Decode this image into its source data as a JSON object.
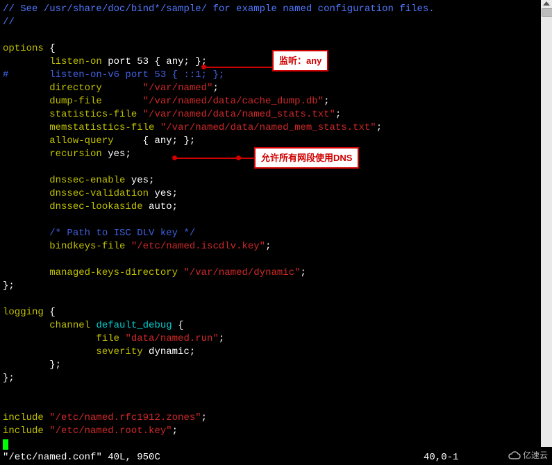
{
  "editor": {
    "filename": "/etc/named.conf",
    "lines_cols": "40L, 950C",
    "cursor_pos": "40,0-1",
    "comment1": "// See /usr/share/doc/bind*/sample/ for example named configuration files.",
    "comment2": "//",
    "options_kw": "options",
    "lbrace": "{",
    "rbrace_semi": "};",
    "listen_on": "listen-on",
    "port_kw": "port",
    "port_val": "53",
    "any_block": "{ any; };",
    "listen_on_v6_line": "#       listen-on-v6 port 53 { ::1; };",
    "directory_kw": "directory",
    "directory_val": "\"/var/named\"",
    "dump_file_kw": "dump-file",
    "dump_file_val": "\"/var/named/data/cache_dump.db\"",
    "stats_file_kw": "statistics-file",
    "stats_file_val": "\"/var/named/data/named_stats.txt\"",
    "memstats_kw": "memstatistics-file",
    "memstats_val": "\"/var/named/data/named_mem_stats.txt\"",
    "allow_query_kw": "allow-query",
    "recursion_kw": "recursion",
    "yes_kw": "yes",
    "no_semi": ";",
    "dnssec_enable_kw": "dnssec-enable",
    "dnssec_validation_kw": "dnssec-validation",
    "dnssec_lookaside_kw": "dnssec-lookaside",
    "auto_kw": "auto",
    "path_comment": "/* Path to ISC DLV key */",
    "bindkeys_kw": "bindkeys-file",
    "bindkeys_val": "\"/etc/named.iscdlv.key\"",
    "managed_keys_kw": "managed-keys-directory",
    "managed_keys_val": "\"/var/named/dynamic\"",
    "logging_kw": "logging",
    "channel_kw": "channel",
    "default_debug": "default_debug",
    "file_kw": "file",
    "file_val": "\"data/named.run\"",
    "severity_kw": "severity",
    "dynamic_kw": "dynamic",
    "include_kw": "include",
    "include1_val": "\"/etc/named.rfc1912.zones\"",
    "include2_val": "\"/etc/named.root.key\""
  },
  "annotations": {
    "a1": "监听：any",
    "a2": "允许所有网段使用DNS"
  },
  "watermark": "亿速云"
}
